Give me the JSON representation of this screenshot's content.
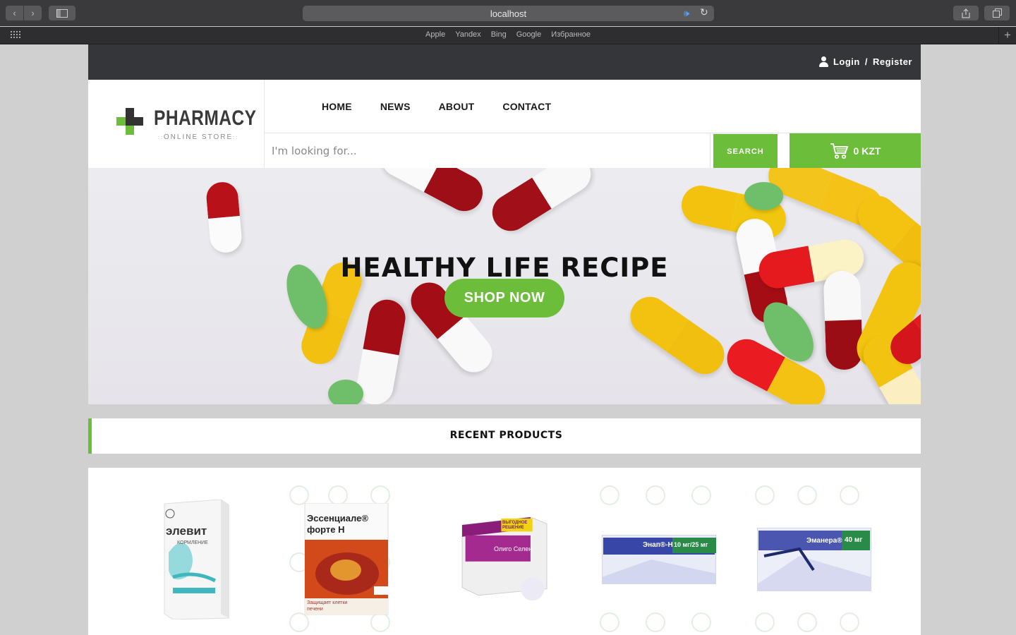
{
  "browser": {
    "address": "localhost",
    "favorites": [
      "Apple",
      "Yandex",
      "Bing",
      "Google",
      "Избранное"
    ]
  },
  "site": {
    "auth": {
      "login": "Login",
      "separator": "/",
      "register": "Register"
    },
    "logo": {
      "title": "PHARMACY",
      "subtitle": "ONLINE STORE"
    },
    "menu": [
      "HOME",
      "NEWS",
      "ABOUT",
      "CONTACT"
    ],
    "search": {
      "placeholder": "I'm looking for...",
      "button": "SEARCH"
    },
    "cart": {
      "total": "0 KZT"
    },
    "hero": {
      "title": "HEALTHY LIFE RECIPE",
      "cta": "SHOP NOW"
    },
    "recent": {
      "title": "RECENT PRODUCTS"
    },
    "products": [
      {
        "brand": "элевит",
        "sub": "КОРМЛЕНИЕ"
      },
      {
        "brand": "Эссенциале® форте Н",
        "sub": "Защищает клетки печени"
      },
      {
        "brand": "Олиго Селен",
        "sub": "ВЫГОДНОЕ РЕШЕНИЕ"
      },
      {
        "brand": "Энап®-Н",
        "sub": "10 мг/25 мг"
      },
      {
        "brand": "Эманера®",
        "sub": "40 мг"
      }
    ],
    "colors": {
      "accent": "#6bbd3a",
      "topbar": "#353639",
      "text": "#111111"
    }
  }
}
